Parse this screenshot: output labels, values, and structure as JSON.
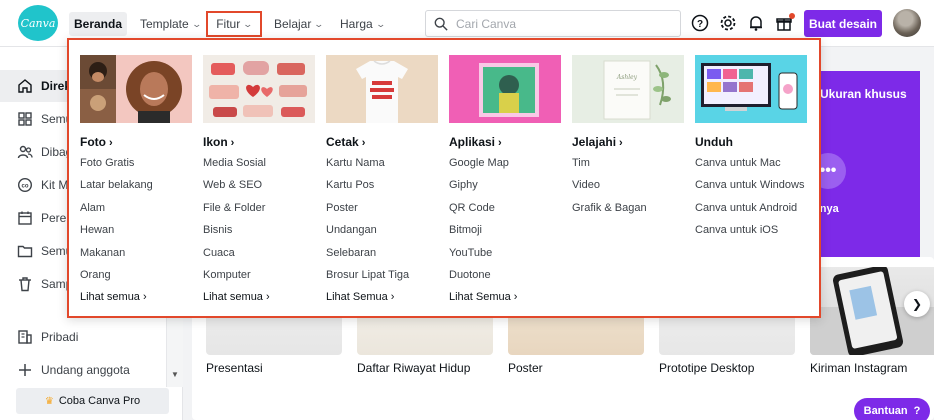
{
  "logo_text": "Canva",
  "nav": {
    "home": "Beranda",
    "template": "Template",
    "features": "Fitur",
    "learn": "Belajar",
    "pricing": "Harga"
  },
  "search": {
    "placeholder": "Cari Canva"
  },
  "create_button": "Buat desain",
  "sidebar": {
    "items": [
      {
        "label": "Direktori",
        "icon": "home-icon"
      },
      {
        "label": "Semua desain",
        "icon": "grid-icon"
      },
      {
        "label": "Dibagikan",
        "icon": "people-icon"
      },
      {
        "label": "Kit Merek",
        "icon": "brand-icon"
      },
      {
        "label": "Perencana",
        "icon": "calendar-icon"
      },
      {
        "label": "Semua folder",
        "icon": "folder-icon"
      },
      {
        "label": "Sampah",
        "icon": "trash-icon"
      },
      {
        "label": "Pribadi",
        "icon": "building-icon"
      },
      {
        "label": "Undang anggota",
        "icon": "plus-icon"
      }
    ],
    "try_pro": "Coba Canva Pro"
  },
  "main": {
    "custom_size": "Ukuran khusus",
    "more_label": "innya",
    "cards": [
      "Presentasi",
      "Daftar Riwayat Hidup",
      "Poster",
      "Prototipe Desktop",
      "Kiriman Instagram"
    ]
  },
  "help_button": "Bantuan",
  "colors": {
    "brand_purple": "#7d2ae8",
    "highlight_red": "#e2482b",
    "logo_teal": "#20c4cb"
  },
  "dropdown": {
    "columns": [
      {
        "title": "Foto",
        "links": [
          "Foto Gratis",
          "Latar belakang",
          "Alam",
          "Hewan",
          "Makanan",
          "Orang"
        ],
        "more": "Lihat semua"
      },
      {
        "title": "Ikon",
        "links": [
          "Media Sosial",
          "Web & SEO",
          "File & Folder",
          "Bisnis",
          "Cuaca",
          "Komputer"
        ],
        "more": "Lihat semua"
      },
      {
        "title": "Cetak",
        "links": [
          "Kartu Nama",
          "Kartu Pos",
          "Poster",
          "Undangan",
          "Selebaran",
          "Brosur Lipat Tiga"
        ],
        "more": "Lihat Semua"
      },
      {
        "title": "Aplikasi",
        "links": [
          "Google Map",
          "Giphy",
          "QR Code",
          "Bitmoji",
          "YouTube",
          "Duotone"
        ],
        "more": "Lihat Semua"
      },
      {
        "title": "Jelajahi",
        "links": [
          "Tim",
          "Video",
          "Grafik & Bagan"
        ],
        "more": ""
      },
      {
        "title": "Unduh",
        "links": [
          "Canva untuk Mac",
          "Canva untuk Windows",
          "Canva untuk Android",
          "Canva untuk iOS"
        ],
        "more": ""
      }
    ]
  }
}
